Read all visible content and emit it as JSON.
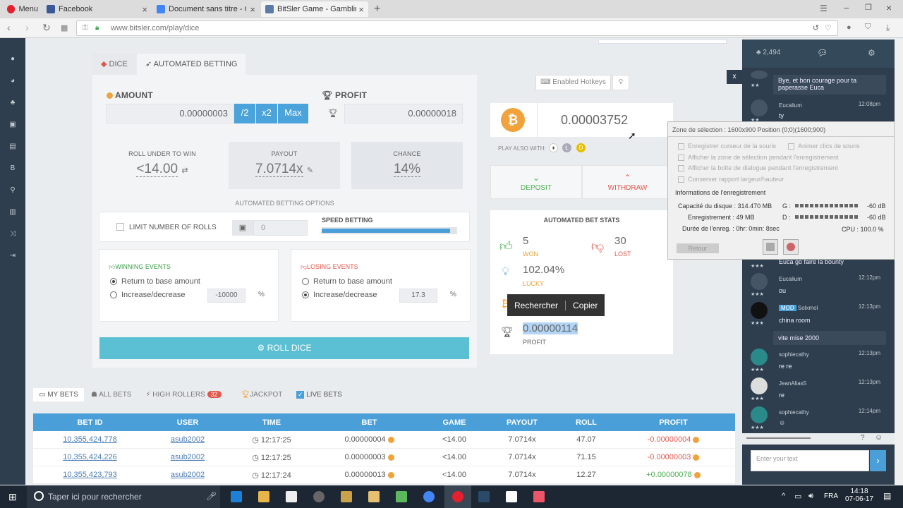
{
  "browser": {
    "menu_label": "Menu",
    "tabs": [
      {
        "label": "Facebook"
      },
      {
        "label": "Document sans titre - Goo"
      },
      {
        "label": "BitSler Game - Gambling B"
      }
    ],
    "url": "www.bitsler.com/play/dice"
  },
  "game": {
    "tab_dice": "DICE",
    "tab_auto": "AUTOMATED BETTING",
    "amount_label": "AMOUNT",
    "amount_value": "0.00000003",
    "btn_half": "/2",
    "btn_double": "x2",
    "btn_max": "Max",
    "profit_label": "PROFIT",
    "profit_value": "0.00000018",
    "roll_under_label": "ROLL UNDER TO WIN",
    "roll_under_value": "<14.00",
    "payout_label": "PAYOUT",
    "payout_value": "7.0714x",
    "chance_label": "CHANCE",
    "chance_value": "14%",
    "options_title": "AUTOMATED BETTING OPTIONS",
    "limit_label": "LIMIT NUMBER OF ROLLS",
    "limit_value": "0",
    "speed_label": "SPEED BETTING",
    "speed_level": 0.95,
    "winning_title": "WINNING EVENTS",
    "losing_title": "LOSING EVENTS",
    "return_base": "Return to base amount",
    "increase_decrease": "Increase/decrease",
    "win_increase_value": "-10000",
    "lose_increase_value": "17.3",
    "percent": "%",
    "roll_button": "ROLL DICE"
  },
  "wallet": {
    "hotkeys": "Enabled Hotkeys",
    "balance": "0.00003752",
    "play_also": "PLAY ALSO WITH:",
    "deposit": "DEPOSIT",
    "withdraw": "WITHDRAW"
  },
  "stats": {
    "title": "AUTOMATED BET STATS",
    "won_value": "5",
    "won_label": "WON",
    "lost_value": "30",
    "lost_label": "LOST",
    "lucky_value": "102.04%",
    "lucky_label": "LUCKY",
    "profit_value": "0.00000114",
    "profit_label": "PROFIT",
    "ctx_search": "Rechercher",
    "ctx_copy": "Copier"
  },
  "bets": {
    "tabs": {
      "my": "MY BETS",
      "all": "ALL BETS",
      "high": "HIGH ROLLERS",
      "high_count": "32",
      "jackpot": "JACKPOT",
      "live": "LIVE BETS"
    },
    "columns": [
      "BET ID",
      "USER",
      "TIME",
      "BET",
      "GAME",
      "PAYOUT",
      "ROLL",
      "PROFIT"
    ],
    "rows": [
      {
        "id": "10,355,424,778",
        "user": "asub2002",
        "time": "12:17:25",
        "bet": "0.00000004",
        "game": "<14.00",
        "payout": "7.0714x",
        "roll": "47.07",
        "profit": "-0.00000004",
        "profit_color": "#e2574c"
      },
      {
        "id": "10,355,424,226",
        "user": "asub2002",
        "time": "12:17:25",
        "bet": "0.00000003",
        "game": "<14.00",
        "payout": "7.0714x",
        "roll": "71.15",
        "profit": "-0.00000003",
        "profit_color": "#e2574c"
      },
      {
        "id": "10,355,423,793",
        "user": "asub2002",
        "time": "12:17:24",
        "bet": "0.00000013",
        "game": "<14.00",
        "payout": "7.0714x",
        "roll": "12.27",
        "profit": "+0.00000078",
        "profit_color": "#4caf50"
      }
    ]
  },
  "chat": {
    "online": "2,494",
    "messages": [
      {
        "name": "",
        "time": "",
        "text": "Bye, et bon courage pour ta paperasse Euca"
      },
      {
        "name": "Eucalium",
        "time": "12:08pm",
        "text": "ty"
      },
      {
        "name": "",
        "time": "",
        "text": "Euca go faire la bounty"
      },
      {
        "name": "Eucalium",
        "time": "12:12pm",
        "text": "ou"
      },
      {
        "name": "Solxmol",
        "badge": "MOD",
        "time": "12:13pm",
        "text": "china room"
      },
      {
        "name": "",
        "time": "",
        "text": "vite mise 2000"
      },
      {
        "name": "sophiecathy",
        "time": "12:13pm",
        "text": "re re"
      },
      {
        "name": "JeanAlias5",
        "time": "12:13pm",
        "text": "re"
      },
      {
        "name": "sophiecathy",
        "time": "12:14pm",
        "text": ""
      }
    ],
    "input_placeholder": "Enter your text",
    "close": "x"
  },
  "recorder": {
    "title": "Zone de sélection : 1600x900 Position (0;0)(1600;900)",
    "opt1": "Enregistrer curseur de la souris",
    "opt1b": "Animer clics de souris",
    "opt2": "Afficher la zone de sélection pendant l'enregistrement",
    "opt3": "Afficher la boîte de dialogue pendant l'enregistrement",
    "opt4": "Conserver rapport largeur/hauteur",
    "info_title": "Informations de l'enregistrement",
    "disk": "Capacité du disque : 314.470 MB",
    "g_label": "G :",
    "g_db": "-60 dB",
    "record": "Enregistrement : 49 MB",
    "d_label": "D :",
    "d_db": "-60 dB",
    "duration": "Durée de l'enreg. : 0hr: 0min: 8sec",
    "cpu": "CPU : 100.0 %",
    "back": "Retour"
  },
  "taskbar": {
    "search": "Taper ici pour rechercher",
    "lang": "FRA",
    "time": "14:18",
    "date": "07-06-17"
  }
}
